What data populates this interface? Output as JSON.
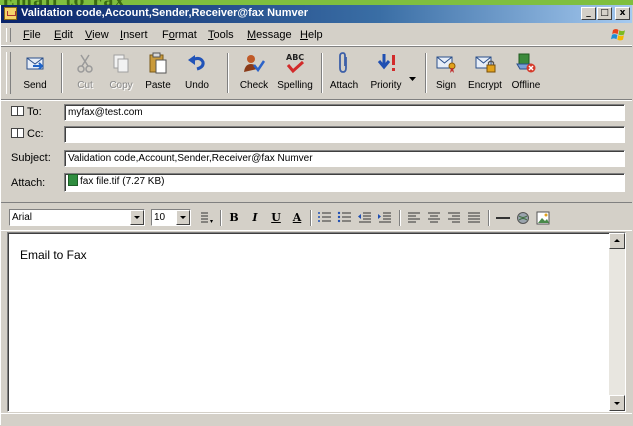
{
  "window": {
    "title": "Validation code,Account,Sender,Receiver@fax Numver",
    "minimize_glyph": "_",
    "maximize_glyph": "□",
    "close_glyph": "x"
  },
  "menu": [
    {
      "label": "File",
      "mnemonic": "F"
    },
    {
      "label": "Edit",
      "mnemonic": "E"
    },
    {
      "label": "View",
      "mnemonic": "V"
    },
    {
      "label": "Insert",
      "mnemonic": "I"
    },
    {
      "label": "Format",
      "mnemonic": "o"
    },
    {
      "label": "Tools",
      "mnemonic": "T"
    },
    {
      "label": "Message",
      "mnemonic": "M"
    },
    {
      "label": "Help",
      "mnemonic": "H"
    }
  ],
  "toolbar": {
    "send": "Send",
    "cut": "Cut",
    "copy": "Copy",
    "paste": "Paste",
    "undo": "Undo",
    "check": "Check",
    "spelling": "Spelling",
    "attach": "Attach",
    "priority": "Priority",
    "sign": "Sign",
    "encrypt": "Encrypt",
    "offline": "Offline"
  },
  "fields": {
    "to_label": "To:",
    "to_value": "myfax@test.com",
    "cc_label": "Cc:",
    "cc_value": "",
    "subject_label": "Subject:",
    "subject_value": "Validation code,Account,Sender,Receiver@fax Numver",
    "attach_label": "Attach:",
    "attach_value": "fax file.tif (7.27 KB)"
  },
  "format": {
    "font": "Arial",
    "size": "10",
    "bold": "B",
    "italic": "I",
    "underline": "U",
    "font_color": "A"
  },
  "body": {
    "text": "Email to Fax"
  },
  "colors": {
    "titlebar_start": "#0a246a",
    "titlebar_end": "#a6caf0",
    "chrome": "#d4d0c8"
  }
}
